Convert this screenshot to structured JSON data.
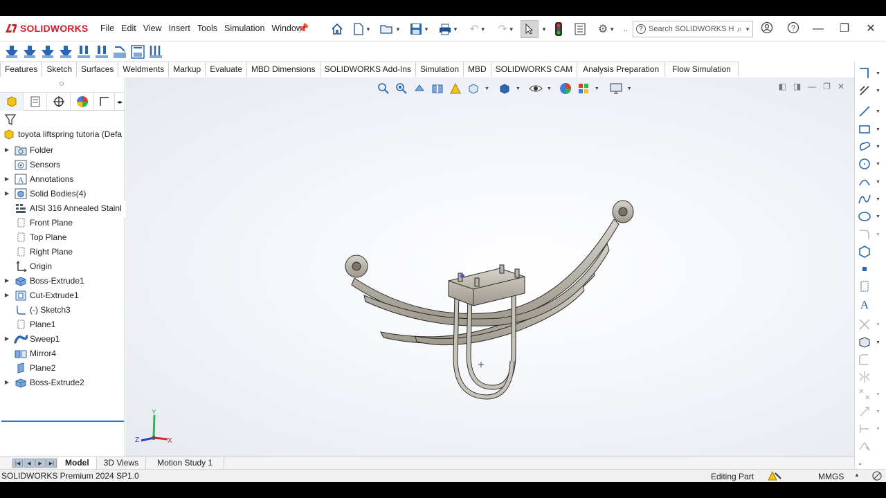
{
  "app": {
    "brand": "SOLIDWORKS",
    "menu": [
      "File",
      "Edit",
      "View",
      "Insert",
      "Tools",
      "Simulation",
      "Window"
    ],
    "search_placeholder": "Search SOLIDWORKS H",
    "colors": {
      "brand_red": "#d0202e",
      "accent_blue": "#1f4f8f",
      "rollback_bar": "#2a74c7",
      "part_gray": "#b9b3a8"
    }
  },
  "command_tabs": [
    "Features",
    "Sketch",
    "Surfaces",
    "Weldments",
    "Markup",
    "Evaluate",
    "MBD Dimensions",
    "SOLIDWORKS Add-Ins",
    "Simulation",
    "MBD",
    "SOLIDWORKS CAM",
    "Analysis Preparation",
    "Flow Simulation"
  ],
  "feature_tree": {
    "root": "toyota liftspring tutoria (Defa",
    "items": [
      {
        "label": "Folder",
        "expandable": true,
        "icon": "folder-icon"
      },
      {
        "label": "Sensors",
        "expandable": false,
        "icon": "sensors-icon"
      },
      {
        "label": "Annotations",
        "expandable": true,
        "icon": "annotations-icon"
      },
      {
        "label": "Solid Bodies(4)",
        "expandable": true,
        "icon": "solid-bodies-icon"
      },
      {
        "label": "AISI 316 Annealed Stainl",
        "expandable": false,
        "icon": "material-icon"
      },
      {
        "label": "Front Plane",
        "expandable": false,
        "icon": "plane-icon"
      },
      {
        "label": "Top Plane",
        "expandable": false,
        "icon": "plane-icon"
      },
      {
        "label": "Right Plane",
        "expandable": false,
        "icon": "plane-icon"
      },
      {
        "label": "Origin",
        "expandable": false,
        "icon": "origin-icon"
      },
      {
        "label": "Boss-Extrude1",
        "expandable": true,
        "icon": "boss-extrude-icon"
      },
      {
        "label": "Cut-Extrude1",
        "expandable": true,
        "icon": "cut-extrude-icon"
      },
      {
        "label": "(-) Sketch3",
        "expandable": false,
        "icon": "sketch-icon"
      },
      {
        "label": "Plane1",
        "expandable": false,
        "icon": "plane-icon"
      },
      {
        "label": "Sweep1",
        "expandable": true,
        "icon": "sweep-icon"
      },
      {
        "label": "Mirror4",
        "expandable": false,
        "icon": "mirror-icon"
      },
      {
        "label": "Plane2",
        "expandable": false,
        "icon": "plane-icon"
      },
      {
        "label": "Boss-Extrude2",
        "expandable": true,
        "icon": "boss-extrude-icon"
      }
    ]
  },
  "bottom_tabs": [
    "Model",
    "3D Views",
    "Motion Study 1"
  ],
  "triad": {
    "x": "X",
    "y": "Y",
    "z": "Z"
  },
  "status": {
    "version": "SOLIDWORKS Premium 2024 SP1.0",
    "mode": "Editing Part",
    "units": "MMGS"
  }
}
